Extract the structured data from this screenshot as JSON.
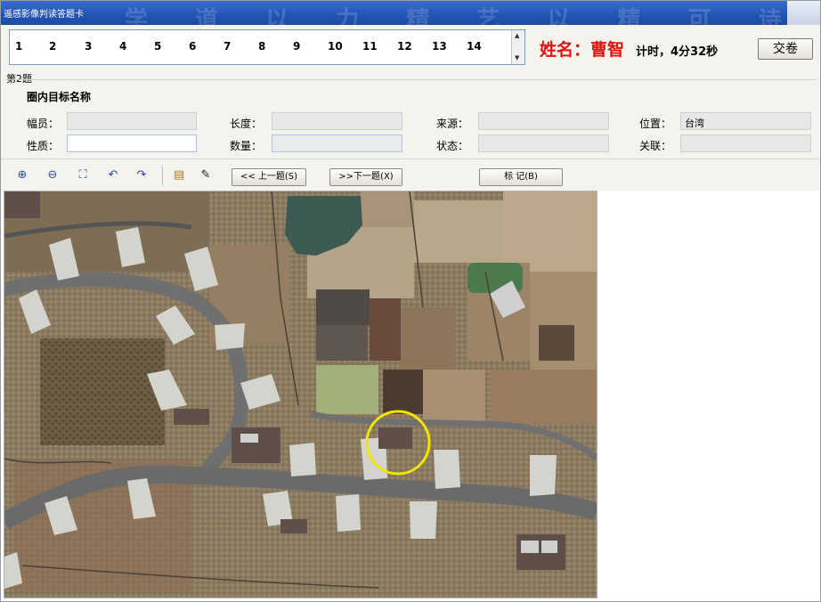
{
  "window": {
    "title": "遥感影像判读答题卡",
    "watermark": "学 道 以 力 精 艺 以 精 可 诗"
  },
  "question_numbers": [
    "1",
    "2",
    "3",
    "4",
    "5",
    "6",
    "7",
    "8",
    "9",
    "10",
    "11",
    "12",
    "13",
    "14"
  ],
  "candidate": {
    "name_label": "姓名：曹智",
    "timer": "计时，4分32秒"
  },
  "buttons": {
    "submit": "交卷",
    "prev": "<< 上一题(S)",
    "next": ">>下一题(X)",
    "mark": "标 记(B)"
  },
  "question_label": "第2题",
  "section_title": "圈内目标名称",
  "fields": {
    "fuyuan": {
      "label": "幅员：",
      "value": ""
    },
    "changdu": {
      "label": "长度：",
      "value": ""
    },
    "laiyuan": {
      "label": "来源：",
      "value": ""
    },
    "weizhi": {
      "label": "位置：",
      "value": "台湾"
    },
    "xingzhi": {
      "label": "性质：",
      "value": ""
    },
    "shuliang": {
      "label": "数量：",
      "value": ""
    },
    "zhuangtai": {
      "label": "状态：",
      "value": ""
    },
    "guanlian": {
      "label": "关联：",
      "value": ""
    }
  },
  "toolbar_icons": [
    "zoom-in-icon",
    "zoom-out-icon",
    "fit-view-icon",
    "back-icon",
    "forward-icon",
    "layer-icon",
    "pencil-icon"
  ],
  "colors": {
    "title_bar": "#2456b8",
    "name_red": "#e01010",
    "circle_marker": "#f2e600",
    "runway": "#6f6f6f",
    "pad": "#d4d4cf"
  }
}
